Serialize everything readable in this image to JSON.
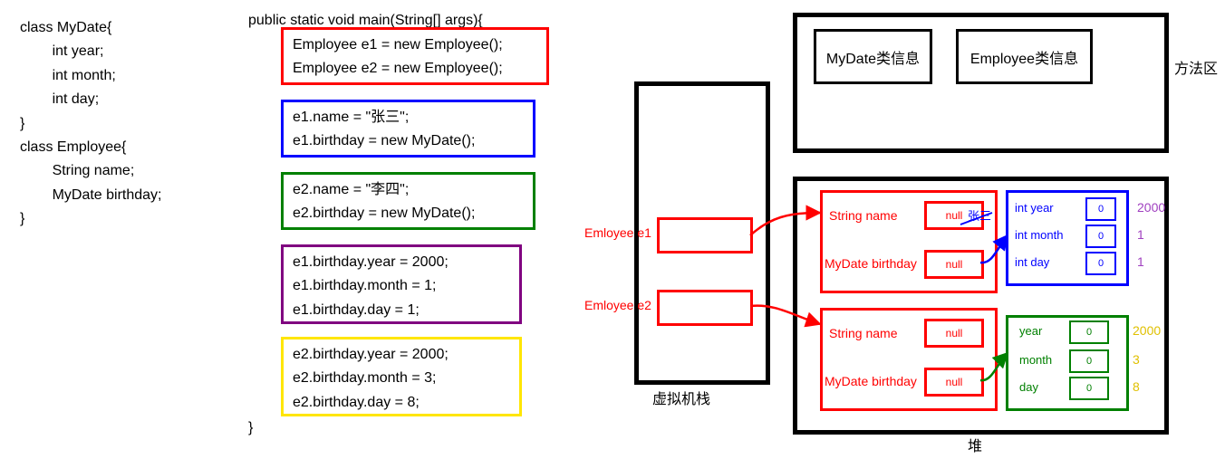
{
  "code_left": {
    "l1": "class MyDate{",
    "l2": "        int year;",
    "l3": "        int month;",
    "l4": "        int day;",
    "l5": "}",
    "l6": "class Employee{",
    "l7": "        String name;",
    "l8": "        MyDate birthday;",
    "l9": "}"
  },
  "code_main": {
    "header": "public static void main(String[] args){",
    "red1": "Employee e1 = new Employee();",
    "red2": "Employee e2 = new Employee();",
    "blue1": "e1.name = \"张三\";",
    "blue2": "e1.birthday = new MyDate();",
    "green1": "e2.name = \"李四\";",
    "green2": "e2.birthday = new MyDate();",
    "purple1": "e1.birthday.year = 2000;",
    "purple2": "e1.birthday.month = 1;",
    "purple3": "e1.birthday.day = 1;",
    "yellow1": "e2.birthday.year = 2000;",
    "yellow2": "e2.birthday.month = 3;",
    "yellow3": "e2.birthday.day = 8;",
    "footer": "}"
  },
  "labels": {
    "method_area": "方法区",
    "vm_stack": "虚拟机栈",
    "heap": "堆",
    "mydate_info": "MyDate类信息",
    "employee_info": "Employee类信息",
    "e1": "Emloyee e1",
    "e2": "Emloyee e2",
    "string_name": "String name",
    "mydate_birthday": "MyDate birthday",
    "nullv": "null",
    "zhangsan": "张三",
    "int_year": "int year",
    "int_month": "int month",
    "int_day": "int day",
    "year": "year",
    "month": "month",
    "day": "day",
    "zero": "0"
  },
  "values": {
    "e1_year": "2000",
    "e1_month": "1",
    "e1_day": "1",
    "e2_year": "2000",
    "e2_month": "3",
    "e2_day": "8"
  },
  "colors": {
    "red": "#ff0000",
    "blue": "#0000ff",
    "green": "#008000",
    "purple": "#800080",
    "yellow": "#ffe600",
    "black": "#000000"
  }
}
